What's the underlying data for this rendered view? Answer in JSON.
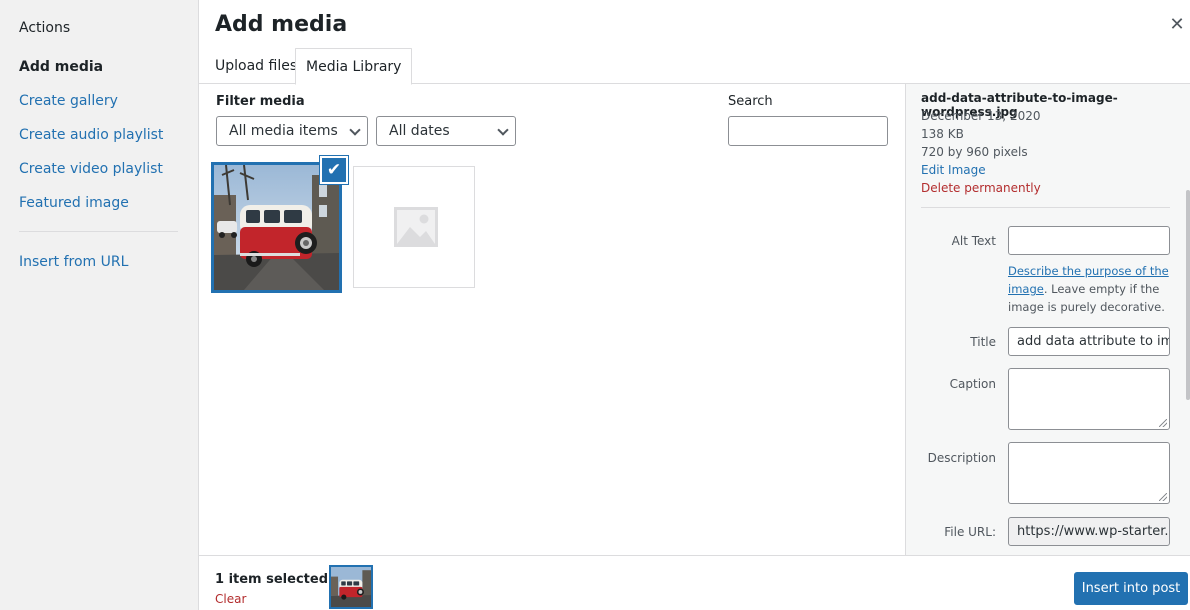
{
  "sidebar": {
    "heading": "Actions",
    "items": [
      {
        "label": "Add media"
      },
      {
        "label": "Create gallery"
      },
      {
        "label": "Create audio playlist"
      },
      {
        "label": "Create video playlist"
      },
      {
        "label": "Featured image"
      }
    ],
    "insert_from_url": "Insert from URL"
  },
  "header": {
    "title": "Add media",
    "close_glyph": "✕"
  },
  "tabs": [
    {
      "label": "Upload files",
      "active": false
    },
    {
      "label": "Media Library",
      "active": true
    }
  ],
  "filter": {
    "label": "Filter media",
    "media_type": "All media items",
    "dates": "All dates",
    "search_label": "Search",
    "search_value": ""
  },
  "attachments": [
    {
      "kind": "image",
      "selected": true,
      "icon": "van-photo"
    },
    {
      "kind": "placeholder",
      "selected": false,
      "icon": "image-placeholder-icon"
    }
  ],
  "details": {
    "filename": "add-data-attribute-to-image-wordpress.jpg",
    "date": "December 13, 2020",
    "size": "138 KB",
    "dimensions": "720 by 960 pixels",
    "edit_link": "Edit Image",
    "delete_link": "Delete permanently",
    "fields": {
      "alt_label": "Alt Text",
      "alt_value": "",
      "alt_help_link": "Describe the purpose of the image",
      "alt_help_rest": ". Leave empty if the image is purely decorative.",
      "title_label": "Title",
      "title_value": "add data attribute to ima",
      "caption_label": "Caption",
      "description_label": "Description",
      "file_url_label": "File URL:",
      "file_url_value": "https://www.wp-starter.co"
    }
  },
  "footer": {
    "selected_count": "1 item selected",
    "clear_label": "Clear",
    "insert_label": "Insert into post"
  },
  "colors": {
    "accent": "#2271b1",
    "danger": "#b32d2e",
    "sidebar_bg": "#f1f1f1"
  }
}
